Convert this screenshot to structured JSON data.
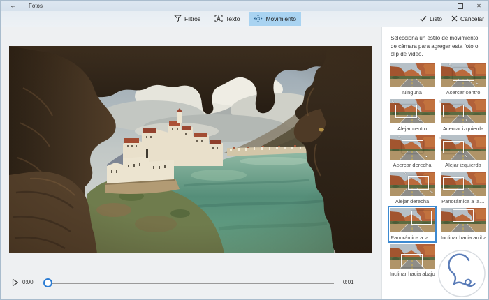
{
  "window": {
    "title": "Fotos"
  },
  "icons": {
    "back": "←",
    "close": "✕"
  },
  "toolbar": {
    "tabs": [
      {
        "label": "Filtros",
        "icon": "filter-icon",
        "active": false
      },
      {
        "label": "Texto",
        "icon": "text-icon",
        "active": false
      },
      {
        "label": "Movimiento",
        "icon": "motion-icon",
        "active": true
      }
    ],
    "done": "Listo",
    "cancel": "Cancelar"
  },
  "player": {
    "elapsed": "0:00",
    "duration": "0:01",
    "progress_percent": 0
  },
  "sidebar": {
    "instruction": "Selecciona un estilo de movimiento de cámara para agregar esta foto o clip de video.",
    "selected_option": "Panorámica a la…",
    "options": [
      {
        "label": "Ninguna",
        "overlay": "none",
        "selected": false
      },
      {
        "label": "Acercar centro",
        "overlay": "center",
        "arrows": true,
        "selected": false
      },
      {
        "label": "Alejar centro",
        "overlay": "center-left",
        "arrows": true,
        "selected": false
      },
      {
        "label": "Acercar izquierda",
        "overlay": "left",
        "arrows": true,
        "selected": false
      },
      {
        "label": "Acercar derecha",
        "overlay": "center",
        "arrows": true,
        "selected": false
      },
      {
        "label": "Alejar izquierda",
        "overlay": "left",
        "arrows": true,
        "selected": false
      },
      {
        "label": "Alejar derecha",
        "overlay": "center-right",
        "arrows": true,
        "selected": false
      },
      {
        "label": "Panorámica a la…",
        "overlay": "left",
        "arrows": false,
        "selected": false
      },
      {
        "label": "Panorámica a la…",
        "overlay": "right",
        "arrows": false,
        "selected": true
      },
      {
        "label": "Inclinar hacia arriba",
        "overlay": "top",
        "arrows": false,
        "selected": false
      },
      {
        "label": "Inclinar hacia abajo",
        "overlay": "bottom",
        "arrows": false,
        "selected": false
      }
    ]
  },
  "colors": {
    "accent": "#2b7cd3",
    "tab_highlight": "#a9d3f1",
    "selected_border": "#3d8ad1",
    "titlebar": "#dbe5ef",
    "sidebar_bg": "#ffffff"
  }
}
